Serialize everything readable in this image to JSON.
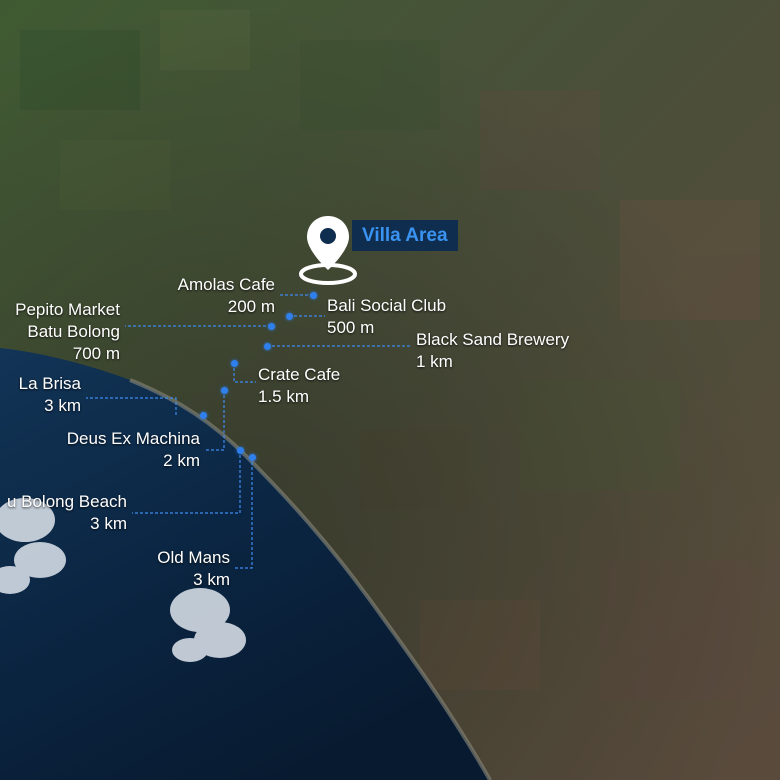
{
  "map": {
    "colors": {
      "accent": "#2f80ed",
      "tag_bg": "#0f2d4f",
      "tag_text": "#3a93f0",
      "ocean": "#0b2038",
      "land": "#3a4a2e"
    },
    "villa": {
      "label": "Villa Area",
      "icon": "map-pin-icon"
    },
    "places": [
      {
        "id": "amolas-cafe",
        "name": "Amolas Cafe",
        "distance": "200 m"
      },
      {
        "id": "bali-social-club",
        "name": "Bali Social Club",
        "distance": "500 m"
      },
      {
        "id": "pepito-market",
        "name": "Pepito Market",
        "name2": "Batu Bolong",
        "distance": "700 m"
      },
      {
        "id": "black-sand-brewery",
        "name": "Black Sand Brewery",
        "distance": "1 km"
      },
      {
        "id": "crate-cafe",
        "name": "Crate Cafe",
        "distance": "1.5 km"
      },
      {
        "id": "la-brisa",
        "name": "La Brisa",
        "distance": "3 km"
      },
      {
        "id": "deus-ex-machina",
        "name": "Deus Ex Machina",
        "distance": "2 km"
      },
      {
        "id": "batu-bolong-beach",
        "name": "u Bolong Beach",
        "distance": "3 km"
      },
      {
        "id": "old-mans",
        "name": "Old Mans",
        "distance": "3 km"
      }
    ]
  }
}
